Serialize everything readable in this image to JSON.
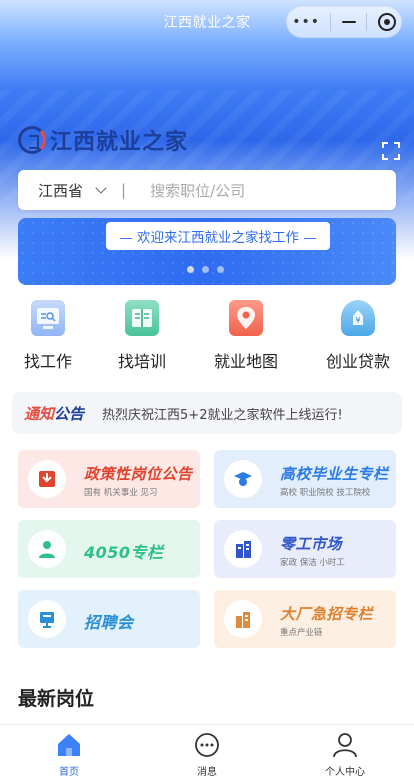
{
  "nav": {
    "title": "江西就业之家",
    "capsule_more": "•••"
  },
  "brand": {
    "name": "江西就业之家"
  },
  "search": {
    "province": "江西省",
    "divider": "|",
    "placeholder": "搜索职位/公司"
  },
  "banner": {
    "text": "— 欢迎来江西就业之家找工作 —",
    "slides": 3,
    "active_slide": 1
  },
  "quick_entries": [
    {
      "label": "找工作",
      "icon": "monitor-search-icon",
      "color": "#8fb4f5"
    },
    {
      "label": "找培训",
      "icon": "book-icon",
      "color": "#49c39a"
    },
    {
      "label": "就业地图",
      "icon": "map-pin-icon",
      "color": "#f0624d"
    },
    {
      "label": "创业贷款",
      "icon": "money-bag-icon",
      "color": "#4aa8e8"
    }
  ],
  "notice": {
    "tag_a": "通知",
    "tag_b": "公告",
    "text": "热烈庆祝江西5+2就业之家软件上线运行!"
  },
  "cards": [
    {
      "title": "政策性岗位公告",
      "sub": "国有  机关事业  见习",
      "icon": "inbox-icon",
      "bg": "#fde8e6",
      "color": "#e0442f",
      "iconColor": "#e0442f"
    },
    {
      "title": "高校毕业生专栏",
      "sub": "高校  职业院校  技工院校",
      "icon": "graduate-icon",
      "bg": "#e3eefc",
      "color": "#2c7be5",
      "iconColor": "#2c7be5"
    },
    {
      "title": "4050专栏",
      "sub": "",
      "icon": "person-icon",
      "bg": "#e3f7ee",
      "color": "#2fbf8d",
      "iconColor": "#2fbf8d"
    },
    {
      "title": "零工市场",
      "sub": "家政  保洁  小时工",
      "icon": "building-icon",
      "bg": "#e8ecfb",
      "color": "#2f55c9",
      "iconColor": "#2f55c9"
    },
    {
      "title": "招聘会",
      "sub": "",
      "icon": "exhibition-icon",
      "bg": "#e2f1fc",
      "color": "#2b8fd8",
      "iconColor": "#2b8fd8"
    },
    {
      "title": "大厂急招专栏",
      "sub": "重点产业链",
      "icon": "factory-icon",
      "bg": "#fdf0e2",
      "color": "#e0802f",
      "iconColor": "#e08a3a"
    }
  ],
  "latest": {
    "title": "最新岗位"
  },
  "tabs": [
    {
      "label": "首页",
      "icon": "home-icon",
      "active": true
    },
    {
      "label": "消息",
      "icon": "chat-icon",
      "active": false
    },
    {
      "label": "个人中心",
      "icon": "user-icon",
      "active": false
    }
  ]
}
